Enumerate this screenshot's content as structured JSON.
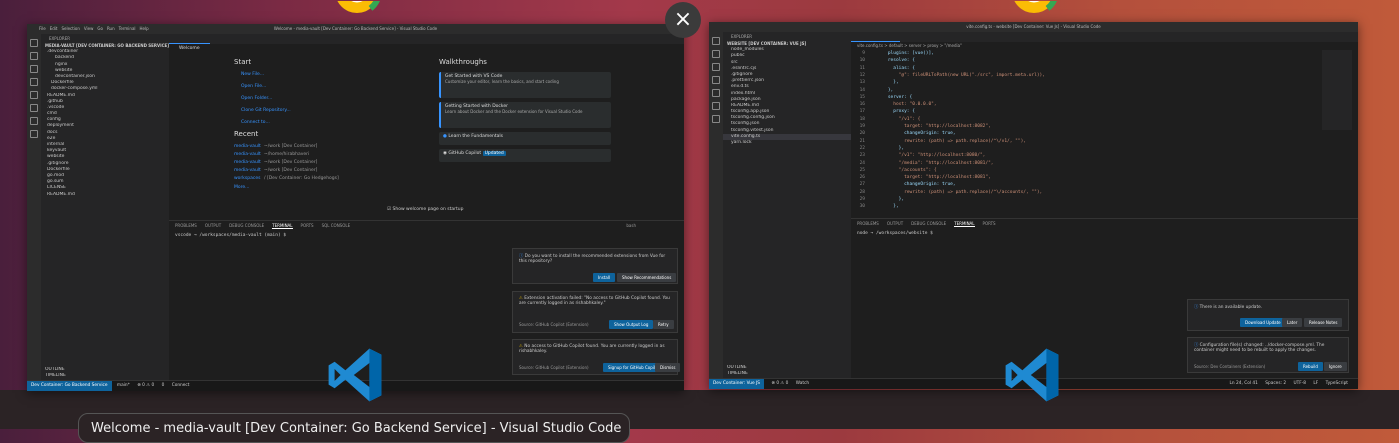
{
  "overview": {
    "close_label": "×",
    "window_label": "Welcome - media-vault [Dev Container: Go Backend Service] - Visual Studio Code"
  },
  "window1": {
    "title": "Welcome - media-vault [Dev Container: Go Backend Service] - Visual Studio Code",
    "menu": [
      "File",
      "Edit",
      "Selection",
      "View",
      "Go",
      "Run",
      "Terminal",
      "Help"
    ],
    "explorer_header": "EXPLORER",
    "root": "MEDIA-VAULT [DEV CONTAINER: GO BACKEND SERVICE]",
    "files": [
      ".devcontainer",
      "backend",
      "nginx",
      "website",
      "devcontainer.json",
      "Dockerfile",
      "docker-compose.yml",
      "README.md",
      ".github",
      ".vscode",
      "cmd",
      "config",
      "deployment",
      "docs",
      "e2e",
      "internal",
      "keyvault",
      "website",
      ".gitignore",
      "Dockerfile",
      "go.mod",
      "go.sum",
      "LICENSE",
      "README.md"
    ],
    "outline": "OUTLINE",
    "timeline": "TIMELINE",
    "tab": "Welcome",
    "start_header": "Start",
    "start_links": [
      "New File...",
      "Open File...",
      "Open Folder...",
      "Clone Git Repository...",
      "Connect to..."
    ],
    "recent_header": "Recent",
    "recent": [
      {
        "name": "media-vault",
        "path": "~/work [Dev Container]"
      },
      {
        "name": "media-vault",
        "path": "~/home/hirabhaveri"
      },
      {
        "name": "media-vault",
        "path": "~/work [Dev Container]"
      },
      {
        "name": "media-vault",
        "path": "~/work [Dev Container]"
      },
      {
        "name": "workspaces",
        "path": "/ [Dev Container: Go Hedgehogs]"
      }
    ],
    "more": "More...",
    "walk_header": "Walkthroughs",
    "walkthroughs": [
      {
        "title": "Get Started with VS Code",
        "sub": "Customize your editor, learn the basics, and start coding"
      },
      {
        "title": "Getting Started with Docker",
        "sub": "Learn about Docker and the Docker extension for Visual Studio Code"
      },
      {
        "title": "Learn the Fundamentals",
        "sub": ""
      },
      {
        "title": "GitHub Copilot",
        "sub": "Updated"
      }
    ],
    "show_welcome": "Show welcome page on startup",
    "panel_tabs": [
      "PROBLEMS",
      "OUTPUT",
      "DEBUG CONSOLE",
      "TERMINAL",
      "PORTS",
      "SQL CONSOLE"
    ],
    "terminal_prompt": "vscode → /workspaces/media-vault (main) $",
    "terminal_label": "bash",
    "toasts": [
      {
        "text": "Do you want to install the recommended extensions from Vue for this repository?",
        "buttons": [
          "Install",
          "Show Recommendations"
        ]
      },
      {
        "text": "Extension activation failed: \"No access to GitHub Copilot found. You are currently logged in as rishabhkaley.\"",
        "source": "Source: GitHub Copilot (Extension)",
        "buttons": [
          "Show Output Log",
          "Retry"
        ]
      },
      {
        "text": "No access to GitHub Copilot found. You are currently logged in as rishabhkaley.",
        "source": "Source: GitHub Copilot (Extension)",
        "buttons": [
          "Signup for GitHub Copilot",
          "Dismiss"
        ]
      }
    ],
    "status_remote": "Dev Container: Go Backend Service",
    "status_items": [
      "main*",
      "⊗ 0 ⚠ 0",
      "0",
      "Connect"
    ]
  },
  "window2": {
    "title": "vite.config.ts - website [Dev Container: Vue Js] - Visual Studio Code",
    "explorer_header": "EXPLORER",
    "root": "WEBSITE [DEV CONTAINER: VUE JS]",
    "files": [
      "node_modules",
      "public",
      "src",
      ".eslintrc.cjs",
      ".gitignore",
      ".prettierrc.json",
      "env.d.ts",
      "index.html",
      "package.json",
      "README.md",
      "tsconfig.app.json",
      "tsconfig.config.json",
      "tsconfig.json",
      "tsconfig.vitest.json",
      "vite.config.ts",
      "yarn.lock"
    ],
    "outline": "OUTLINE",
    "timeline": "TIMELINE",
    "tab": "vite.config.ts",
    "breadcrumb": "vite.config.ts > default > server > proxy > \"/media\"",
    "code": [
      {
        "n": "9",
        "t": "    plugins: [vue()],"
      },
      {
        "n": "10",
        "t": "    resolve: {"
      },
      {
        "n": "11",
        "t": "      alias: {"
      },
      {
        "n": "12",
        "t": "        \"@\": fileURLToPath(new URL(\"./src\", import.meta.url)),"
      },
      {
        "n": "13",
        "t": "      },"
      },
      {
        "n": "14",
        "t": "    },"
      },
      {
        "n": "15",
        "t": "    server: {"
      },
      {
        "n": "16",
        "t": "      host: \"0.0.0.0\","
      },
      {
        "n": "17",
        "t": "      proxy: {"
      },
      {
        "n": "18",
        "t": "        \"/v1\": {"
      },
      {
        "n": "19",
        "t": "          target: \"http://localhost:8082\","
      },
      {
        "n": "20",
        "t": "          changeOrigin: true,"
      },
      {
        "n": "21",
        "t": "          rewrite: (path) => path.replace(/^\\/v1/, \"\"),"
      },
      {
        "n": "22",
        "t": "        },"
      },
      {
        "n": "23",
        "t": "        \"/v1\": \"http://localhost:8080/\","
      },
      {
        "n": "24",
        "t": "        \"/media\": \"http://localhost:8081/\","
      },
      {
        "n": "25",
        "t": "        \"/accounts\": {"
      },
      {
        "n": "26",
        "t": "          target: \"http://localhost:8081\","
      },
      {
        "n": "27",
        "t": "          changeOrigin: true,"
      },
      {
        "n": "28",
        "t": "          rewrite: (path) => path.replace(/^\\/accounts/, \"\"),"
      },
      {
        "n": "29",
        "t": "        },"
      },
      {
        "n": "30",
        "t": "      },"
      }
    ],
    "panel_tabs": [
      "PROBLEMS",
      "OUTPUT",
      "DEBUG CONSOLE",
      "TERMINAL",
      "PORTS"
    ],
    "terminal_prompt": "node → /workspaces/website $",
    "toasts": [
      {
        "text": "There is an available update.",
        "buttons": [
          "Download Update",
          "Later",
          "Release Notes"
        ]
      },
      {
        "text": "Configuration file(s) changed: ../docker-compose.yml. The container might need to be rebuilt to apply the changes.",
        "source": "Source: Dev Containers (Extension)",
        "buttons": [
          "Rebuild",
          "Ignore"
        ]
      }
    ],
    "status_remote": "Dev Container: Vue JS",
    "status_items": [
      "⊗ 0 ⚠ 0",
      "Watch",
      "Ln 24, Col 41",
      "Spaces: 2",
      "UTF-8",
      "LF",
      "TypeScript"
    ]
  },
  "colors": {
    "accent": "#0e639c",
    "link": "#3794ff"
  }
}
